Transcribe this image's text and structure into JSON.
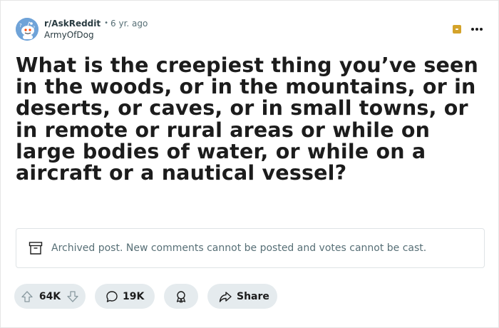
{
  "post": {
    "subreddit": "r/AskReddit",
    "separator": "•",
    "time": "6 yr. ago",
    "author": "ArmyOfDog",
    "title": "What is the creepiest thing you’ve seen in the woods, or in the mountains, or in deserts, or caves, or in small towns, or in remote or rural areas or while on large bodies of water, or while on a aircraft or a nautical vessel?",
    "archived_notice": "Archived post. New comments cannot be posted and votes cannot be cast."
  },
  "actions": {
    "votes": "64K",
    "comments": "19K",
    "share": "Share"
  },
  "icons": {
    "avatar": "reddit-snoo-avatar",
    "archive_badge": "archive-badge-icon",
    "more": "more-options-icon",
    "archive_box": "archive-box-icon",
    "upvote": "upvote-arrow-icon",
    "downvote": "downvote-arrow-icon",
    "comment": "comment-bubble-icon",
    "award": "award-icon",
    "share": "share-arrow-icon"
  },
  "colors": {
    "archive_badge": "#d4a32a",
    "avatar_bg": "#6fa3d8",
    "pill_bg": "#e5ebee",
    "muted_text": "#576f76"
  }
}
